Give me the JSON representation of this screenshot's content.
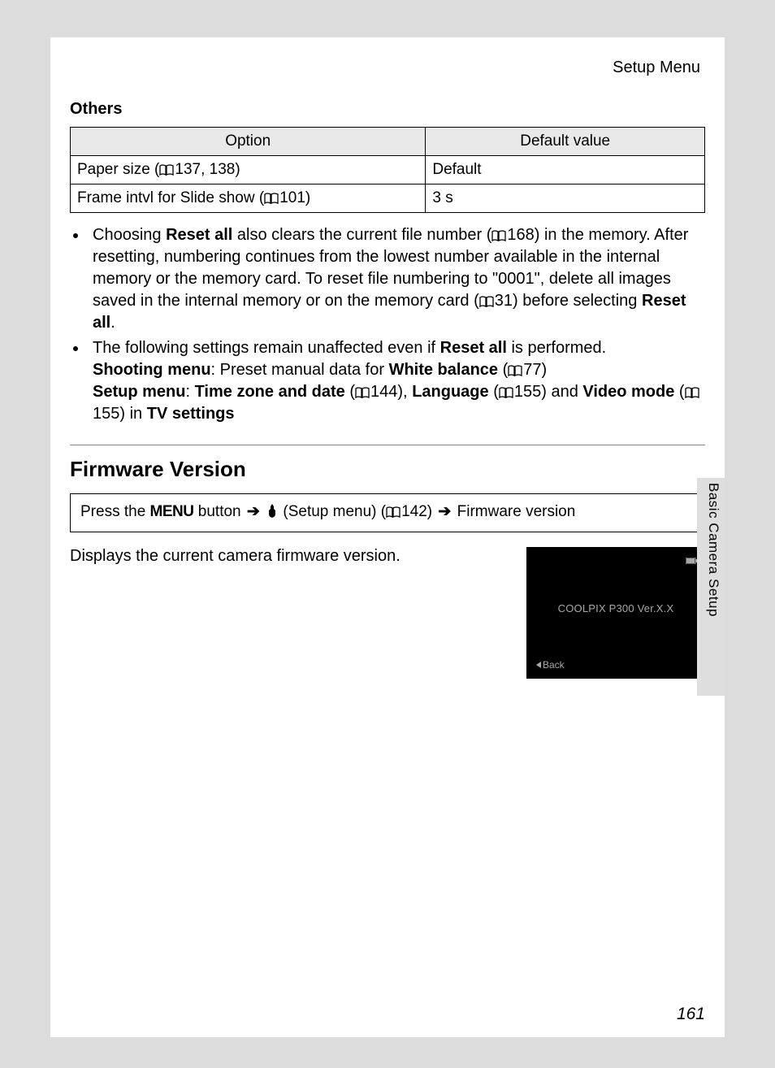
{
  "header": {
    "breadcrumb": "Setup Menu"
  },
  "others": {
    "heading": "Others",
    "col_option": "Option",
    "col_default": "Default value",
    "rows": [
      {
        "option_pre": "Paper size (",
        "option_ref": "137, 138)",
        "value": "Default"
      },
      {
        "option_pre": "Frame intvl for Slide show (",
        "option_ref": "101)",
        "value": "3 s"
      }
    ]
  },
  "bullets": {
    "b1_p1": "Choosing ",
    "b1_reset": "Reset all",
    "b1_p2": " also clears the current file number (",
    "b1_ref1": "168) in the memory. After resetting, numbering continues from the lowest number available in the internal memory or the memory card. To reset file numbering to \"0001\", delete all images saved in the internal memory or on the memory card (",
    "b1_ref2": "31) before selecting ",
    "b1_reset2": "Reset all",
    "b1_p3": ".",
    "b2_p1": "The following settings remain unaffected even if ",
    "b2_reset": "Reset all",
    "b2_p2": " is performed.",
    "b2_shoot": "Shooting menu",
    "b2_p3": ": Preset manual data for ",
    "b2_wb": "White balance",
    "b2_p4": " (",
    "b2_ref1": "77)",
    "b2_setup": "Setup menu",
    "b2_p5": ": ",
    "b2_tz": "Time zone and date",
    "b2_p6": " (",
    "b2_ref2": "144), ",
    "b2_lang": "Language",
    "b2_p7": " (",
    "b2_ref3": "155) and ",
    "b2_vm": "Video mode",
    "b2_p8": " (",
    "b2_ref4": "155) in ",
    "b2_tv": "TV settings"
  },
  "firmware": {
    "heading": "Firmware Version",
    "nav_p1": "Press the ",
    "nav_menu": "MENU",
    "nav_p2": " button ",
    "nav_p3": " (Setup menu) (",
    "nav_ref": "142) ",
    "nav_p4": " Firmware version",
    "desc": "Displays the current camera firmware version.",
    "lcd_text": "COOLPIX P300 Ver.X.X",
    "lcd_back": "Back"
  },
  "side_label": "Basic Camera Setup",
  "page_number": "161"
}
